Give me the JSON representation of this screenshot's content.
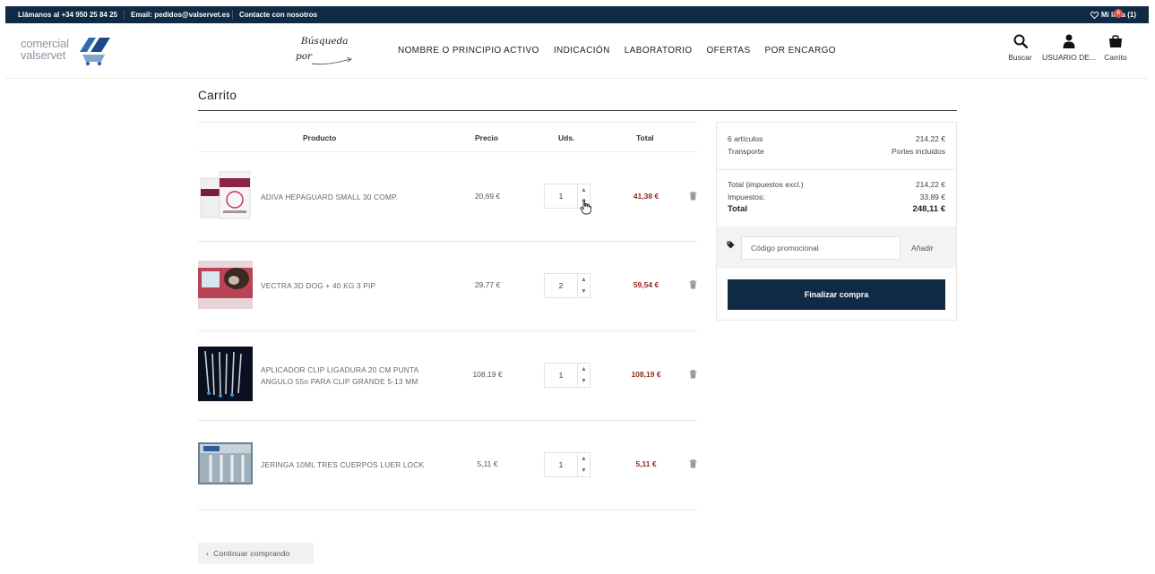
{
  "topbar": {
    "phone": "Llámanos al +34 950 25 84 25",
    "email": "Email: pedidos@valservet.es",
    "contact": "Contacte con nosotros",
    "wishlist": "Mi lista (1)"
  },
  "header": {
    "logo_line1": "comercial",
    "logo_line2": "valservet",
    "search_by_line1": "Búsqueda",
    "search_by_line2": "por",
    "nav": [
      "NOMBRE O PRINCIPIO ACTIVO",
      "INDICACIÓN",
      "LABORATORIO",
      "OFERTAS",
      "POR ENCARGO"
    ],
    "search_label": "Buscar",
    "user_label": "USUARIO DE...",
    "cart_label": "Carrito",
    "cart_count": "6"
  },
  "page": {
    "title": "Carrito",
    "continue_label": "Continuar comprando"
  },
  "table": {
    "headers": {
      "product": "Producto",
      "price": "Precio",
      "qty": "Uds.",
      "total": "Total"
    },
    "rows": [
      {
        "name": "ADIVA HEPAGUARD SMALL 30 COMP.",
        "price": "20,69 €",
        "qty": "1",
        "total": "41,38 €",
        "image": "hepaguard-box"
      },
      {
        "name": "VECTRA 3D DOG + 40 KG 3 PIP",
        "price": "29,77 €",
        "qty": "2",
        "total": "59,54 €",
        "image": "vectra-box"
      },
      {
        "name": "APLICADOR CLIP LIGADURA 20 CM PUNTA ANGULO 55o PARA CLIP GRANDE 5-13 MM",
        "price": "108,19 €",
        "qty": "1",
        "total": "108,19 €",
        "image": "clip-applicators"
      },
      {
        "name": "JERINGA 10ML TRES CUERPOS LUER LOCK",
        "price": "5,11 €",
        "qty": "1",
        "total": "5,11 €",
        "image": "syringe-box"
      }
    ]
  },
  "summary": {
    "items_label": "6 artículos",
    "items_value": "214,22 €",
    "shipping_label": "Transporte",
    "shipping_value": "Portes incluidos",
    "total_excl_label": "Total (impuestos excl.)",
    "total_excl_value": "214,22 €",
    "tax_label": "Impuestos:",
    "tax_value": "33,89 €",
    "total_label": "Total",
    "total_value": "248,11 €",
    "promo_placeholder": "Código promocional",
    "promo_add": "Añadir",
    "checkout_label": "Finalizar compra"
  },
  "colors": {
    "navy": "#0f2a44",
    "price_red": "#8b2d1d",
    "badge": "#d9534f"
  }
}
